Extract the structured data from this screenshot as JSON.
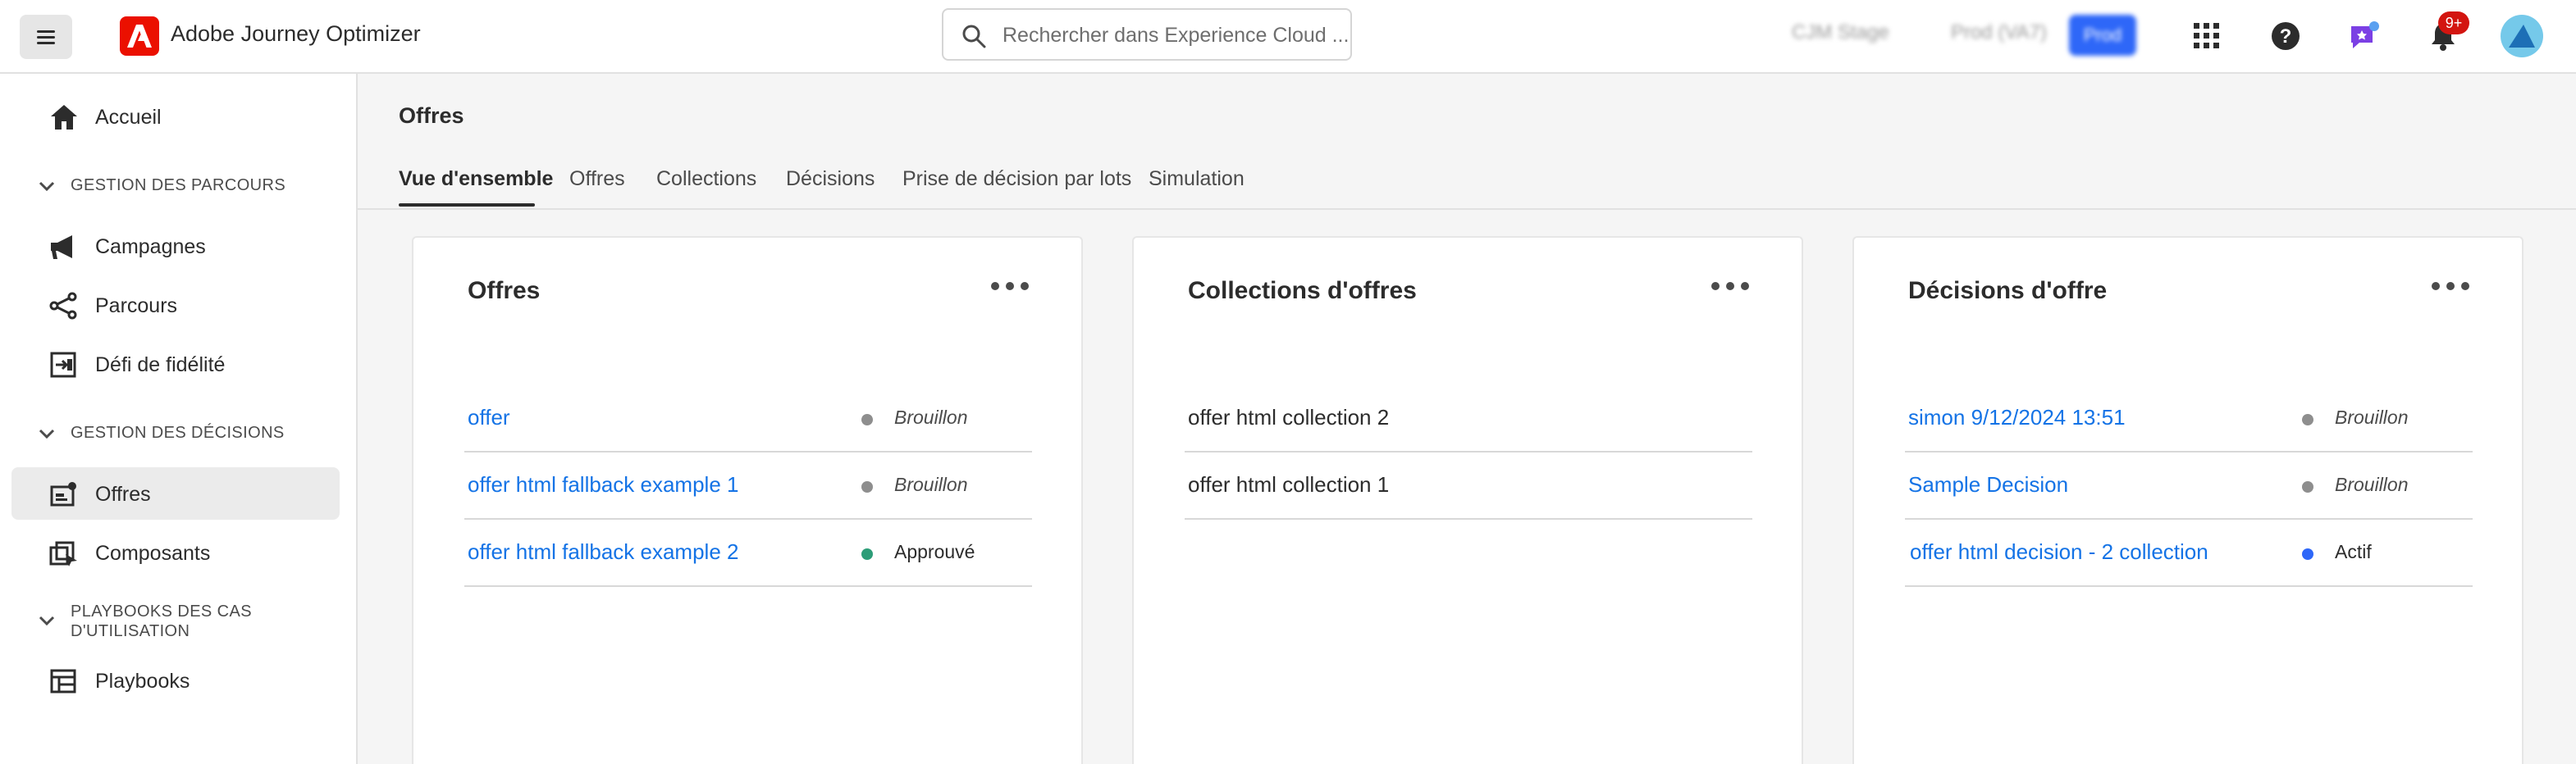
{
  "app": {
    "title": "Adobe Journey Optimizer"
  },
  "search": {
    "placeholder": "Rechercher dans Experience Cloud ..."
  },
  "topbar": {
    "env_blurred": "CJM Stage",
    "sandbox_blurred": "Prod (VA7)",
    "prod_button": "Prod",
    "notification_count": "9+"
  },
  "sidebar": {
    "home": "Accueil",
    "sections": [
      {
        "label": "GESTION DES PARCOURS",
        "items": [
          "Campagnes",
          "Parcours",
          "Défi de fidélité"
        ]
      },
      {
        "label": "GESTION DES DÉCISIONS",
        "items": [
          "Offres",
          "Composants"
        ]
      },
      {
        "label_line1": "PLAYBOOKS DES CAS",
        "label_line2": "D'UTILISATION",
        "items": [
          "Playbooks"
        ]
      }
    ]
  },
  "page": {
    "title": "Offres",
    "tabs": [
      "Vue d'ensemble",
      "Offres",
      "Collections",
      "Décisions",
      "Prise de décision par lots",
      "Simulation"
    ]
  },
  "cards": [
    {
      "title": "Offres",
      "rows": [
        {
          "name": "offer",
          "status": "Brouillon"
        },
        {
          "name": "offer html fallback example 1",
          "status": "Brouillon"
        },
        {
          "name": "offer html fallback example 2",
          "status": "Approuvé"
        }
      ]
    },
    {
      "title": "Collections d'offres",
      "rows": [
        {
          "name": "offer html collection 2"
        },
        {
          "name": "offer html collection 1"
        }
      ]
    },
    {
      "title": "Décisions d'offre",
      "rows": [
        {
          "name": "simon 9/12/2024 13:51",
          "status": "Brouillon"
        },
        {
          "name": "Sample Decision",
          "status": "Brouillon"
        },
        {
          "name": "offer html decision - 2 collection",
          "status": "Actif"
        }
      ]
    }
  ],
  "colors": {
    "link": "#1473e6",
    "draft_dot": "#8e8e8e",
    "approved_dot": "#2d9d78",
    "active_dot": "#2e67f8",
    "adobe_red": "#eb1000",
    "notification_badge": "#d31510"
  }
}
